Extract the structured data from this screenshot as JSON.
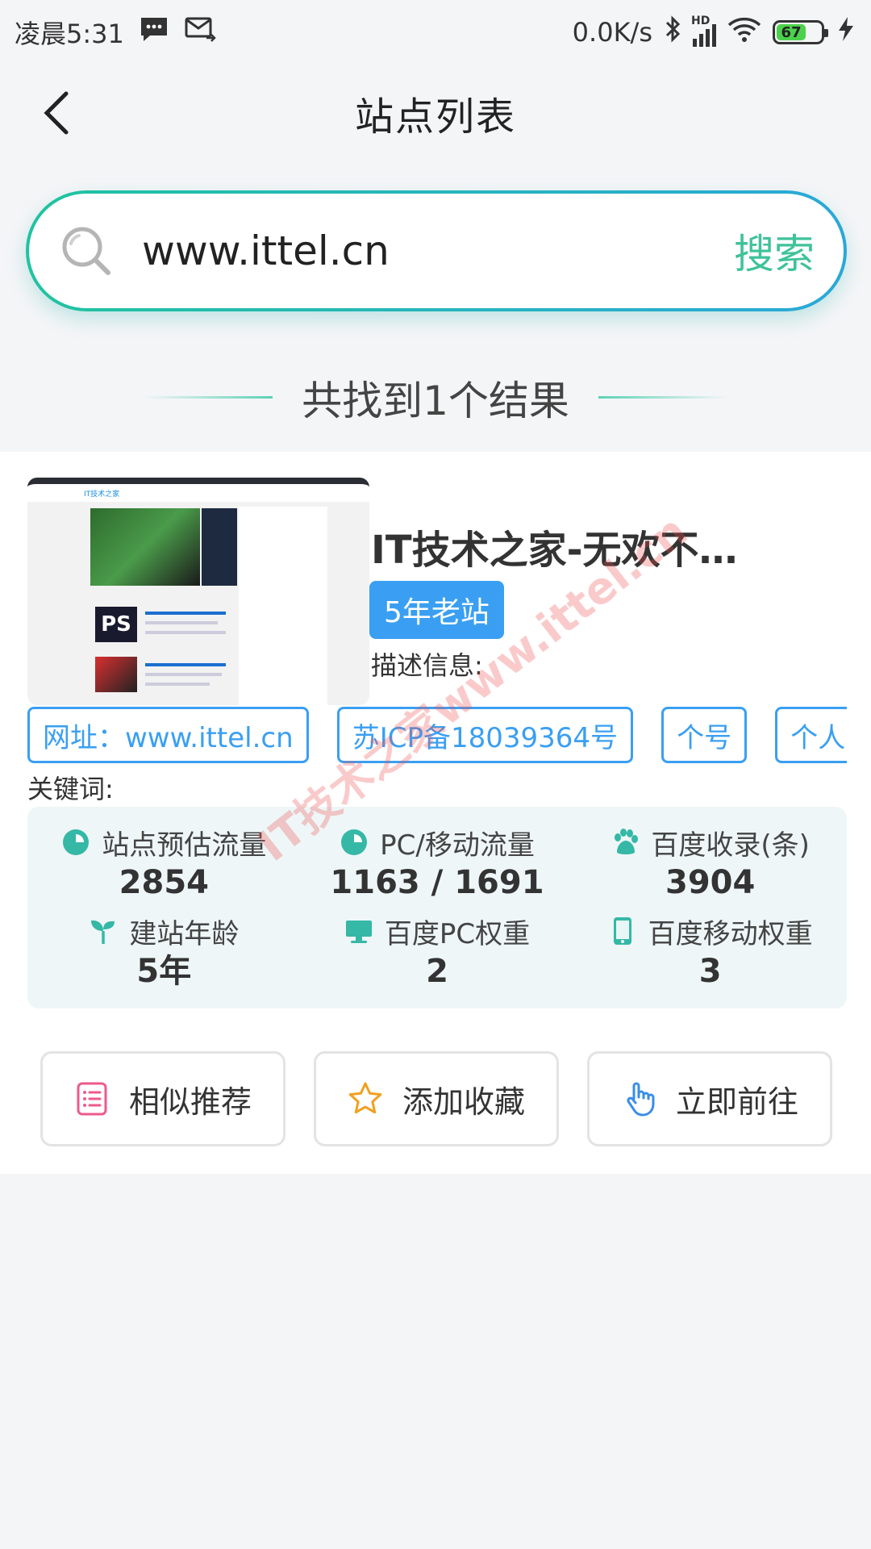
{
  "status_bar": {
    "time": "凌晨5:31",
    "network_speed": "0.0K/s",
    "signal_label": "HD",
    "battery_level": "67",
    "icons": [
      "message-icon",
      "mail-icon",
      "bluetooth-icon",
      "signal-icon",
      "wifi-icon",
      "battery-icon",
      "charging-icon"
    ]
  },
  "nav": {
    "title": "站点列表",
    "back_icon": "chevron-left-icon"
  },
  "search": {
    "value": "www.ittel.cn",
    "button_label": "搜索",
    "icon": "search-icon"
  },
  "result_summary": "共找到1个结果",
  "result": {
    "thumbnail": {
      "site_logo_text": "IT技术之家",
      "ps_text": "PS"
    },
    "title": "IT技术之家-无欢不…",
    "age_badge": "5年老站",
    "description_label": "描述信息:",
    "tags": [
      "网址：www.ittel.cn",
      "苏ICP备18039364号",
      "个号",
      "个人"
    ],
    "keywords_label": "关键词:",
    "stats": [
      {
        "label": "站点预估流量",
        "value": "2854",
        "icon": "pie-chart-icon"
      },
      {
        "label": "PC/移动流量",
        "value": "1163 / 1691",
        "icon": "pie-chart-icon"
      },
      {
        "label": "百度收录(条)",
        "value": "3904",
        "icon": "baidu-paw-icon"
      },
      {
        "label": "建站年龄",
        "value": "5年",
        "icon": "sprout-icon"
      },
      {
        "label": "百度PC权重",
        "value": "2",
        "icon": "monitor-icon"
      },
      {
        "label": "百度移动权重",
        "value": "3",
        "icon": "mobile-phone-icon"
      }
    ],
    "actions": [
      {
        "label": "相似推荐",
        "icon": "list-icon"
      },
      {
        "label": "添加收藏",
        "icon": "star-icon"
      },
      {
        "label": "立即前往",
        "icon": "hand-pointer-icon"
      }
    ]
  },
  "watermark": "IT技术之家www.ittel.cn",
  "colors": {
    "accent_green": "#3fc29a",
    "accent_blue": "#3a9ff2",
    "stat_icon": "#35b8a6",
    "background": "#f4f5f7"
  }
}
